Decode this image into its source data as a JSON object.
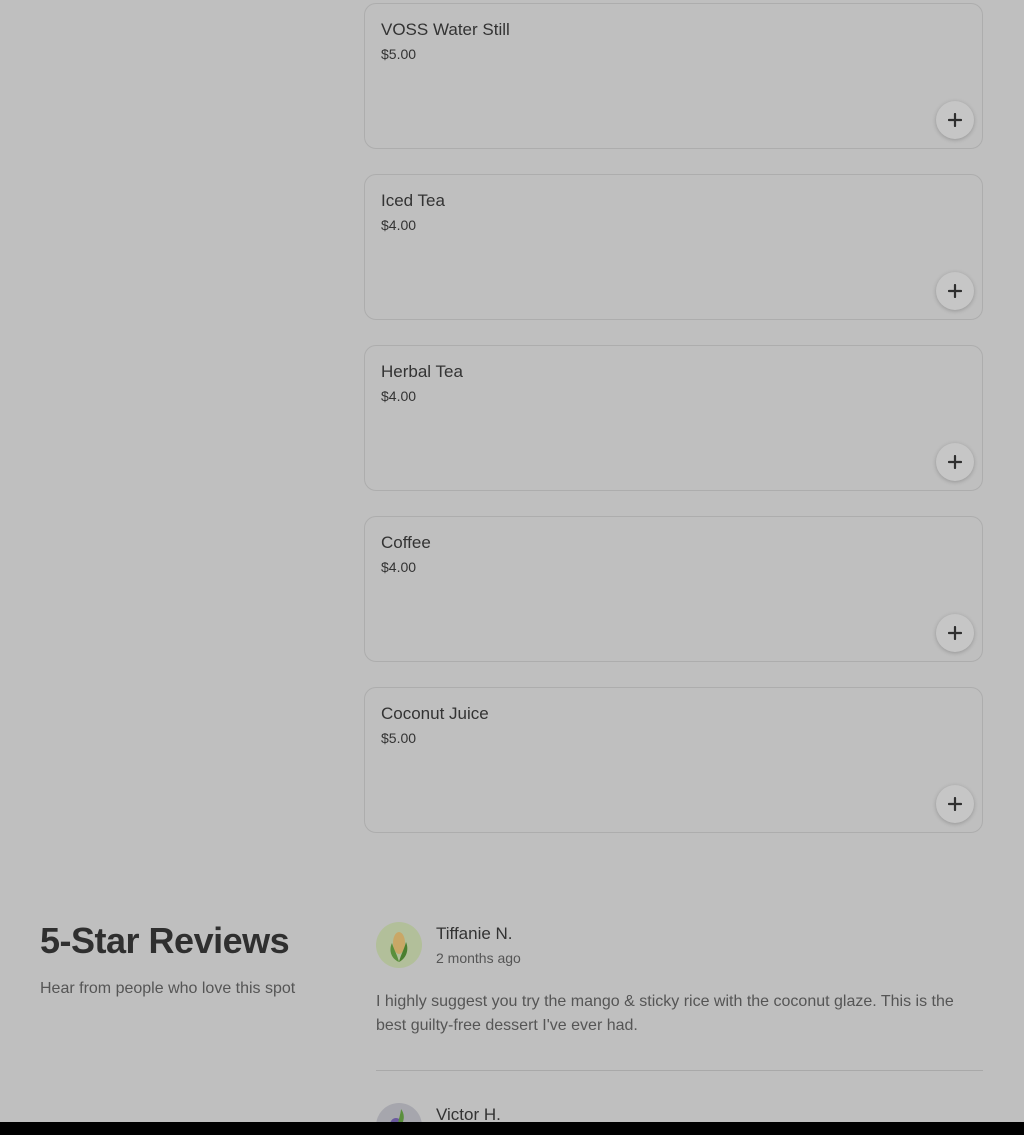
{
  "menu_items": [
    {
      "name": "VOSS Water Still",
      "price": "$5.00"
    },
    {
      "name": "Iced Tea",
      "price": "$4.00"
    },
    {
      "name": "Herbal Tea",
      "price": "$4.00"
    },
    {
      "name": "Coffee",
      "price": "$4.00"
    },
    {
      "name": "Coconut Juice",
      "price": "$5.00"
    }
  ],
  "add_icon": "plus-icon",
  "reviews_section": {
    "title": "5-Star Reviews",
    "subtitle": "Hear from people who love this spot"
  },
  "reviews": [
    {
      "name": "Tiffanie N.",
      "date": "2 months ago",
      "text": "I highly suggest you try the mango & sticky rice with the coconut glaze. This is the best guilty-free dessert I've ever had.",
      "avatar_icon": "corn-icon"
    },
    {
      "name": "Victor H.",
      "avatar_icon": "eggplant-icon"
    }
  ],
  "colors": {
    "overlay_background": "#bfbfbf",
    "text_dark": "#333333",
    "text_muted": "#555555"
  }
}
